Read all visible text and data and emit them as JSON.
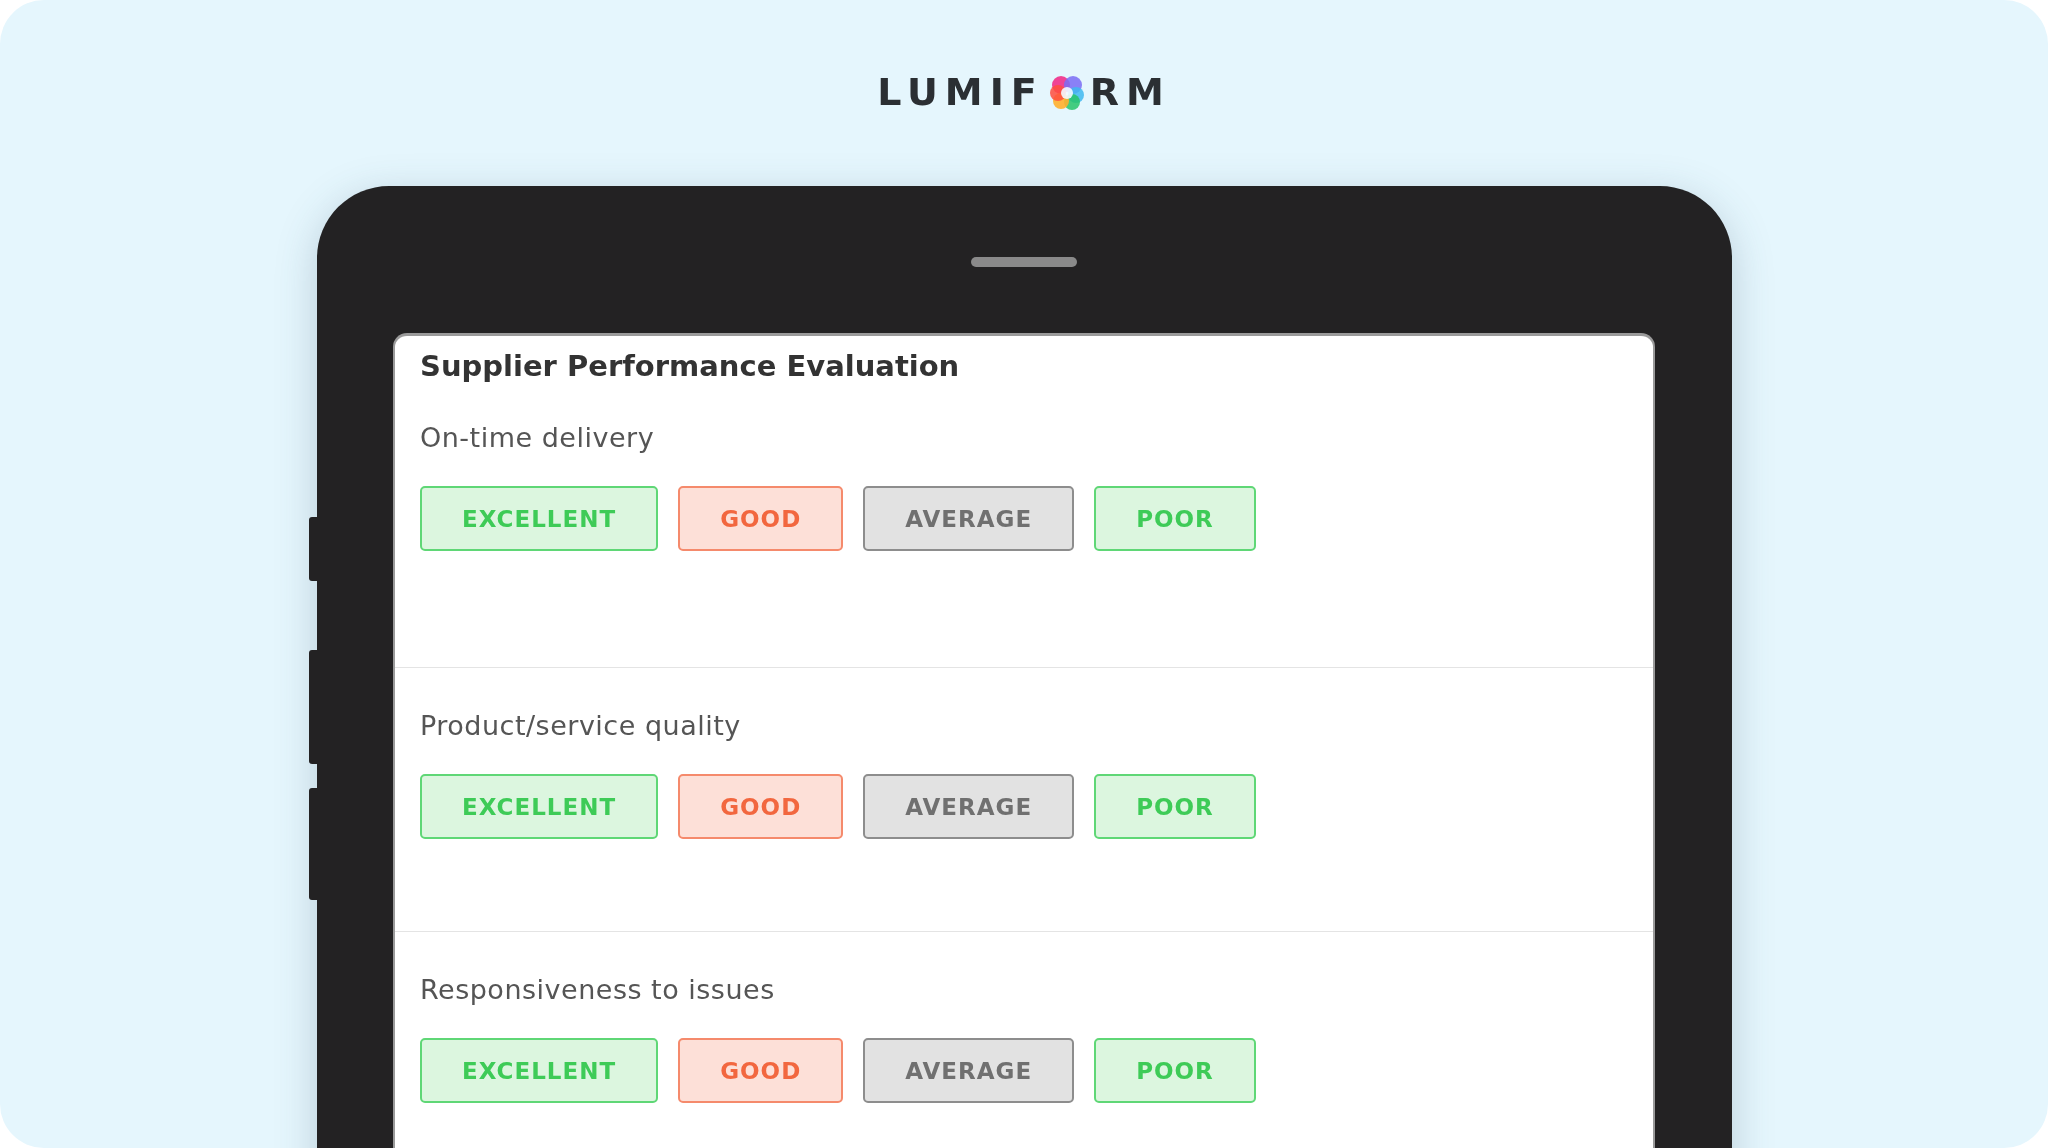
{
  "logo": {
    "before": "LUMIF",
    "after": "RM"
  },
  "form": {
    "title": "Supplier Performance Evaluation",
    "questions": [
      {
        "label": "On-time delivery",
        "options": [
          {
            "label": "EXCELLENT",
            "kind": "excellent"
          },
          {
            "label": "GOOD",
            "kind": "good"
          },
          {
            "label": "AVERAGE",
            "kind": "average"
          },
          {
            "label": "POOR",
            "kind": "poor"
          }
        ]
      },
      {
        "label": "Product/service quality",
        "options": [
          {
            "label": "EXCELLENT",
            "kind": "excellent"
          },
          {
            "label": "GOOD",
            "kind": "good"
          },
          {
            "label": "AVERAGE",
            "kind": "average"
          },
          {
            "label": "POOR",
            "kind": "poor"
          }
        ]
      },
      {
        "label": "Responsiveness to issues",
        "options": [
          {
            "label": "EXCELLENT",
            "kind": "excellent"
          },
          {
            "label": "GOOD",
            "kind": "good"
          },
          {
            "label": "AVERAGE",
            "kind": "average"
          },
          {
            "label": "POOR",
            "kind": "poor"
          }
        ]
      }
    ]
  }
}
